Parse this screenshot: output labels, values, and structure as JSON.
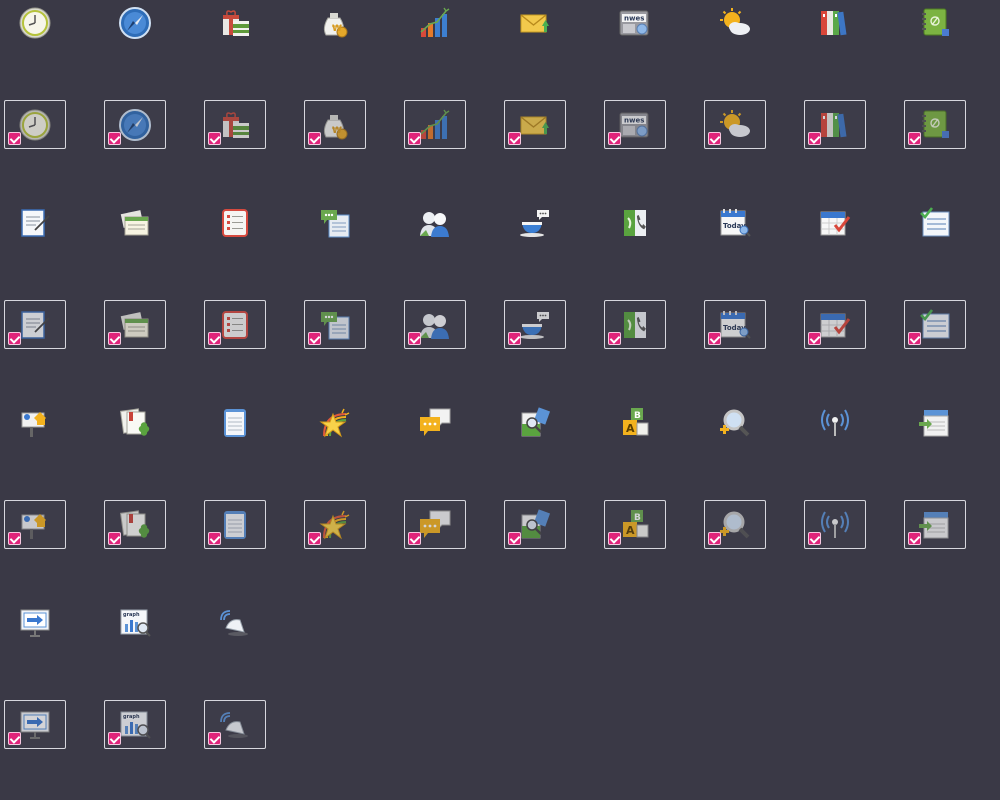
{
  "grid": {
    "rows": [
      {
        "state": "normal",
        "icons": [
          "clock-icon",
          "compass-icon",
          "gift-icon",
          "money-bag-icon",
          "growth-chart-icon",
          "mail-icon",
          "news-icon",
          "weather-icon",
          "binders-icon",
          "notebook-icon"
        ]
      },
      {
        "state": "selected",
        "icons": [
          "clock-icon",
          "compass-icon",
          "gift-icon",
          "money-bag-icon",
          "growth-chart-icon",
          "mail-icon",
          "news-icon",
          "weather-icon",
          "binders-icon",
          "notebook-icon"
        ]
      },
      {
        "state": "normal",
        "icons": [
          "memo-edit-icon",
          "cards-icon",
          "checklist-red-icon",
          "chat-document-icon",
          "users-icon",
          "coffee-icon",
          "phone-book-icon",
          "today-calendar-icon",
          "calendar-check-icon",
          "task-list-icon"
        ]
      },
      {
        "state": "selected",
        "icons": [
          "memo-edit-icon",
          "cards-icon",
          "checklist-red-icon",
          "chat-document-icon",
          "users-icon",
          "coffee-icon",
          "phone-book-icon",
          "today-calendar-icon",
          "calendar-check-icon",
          "task-list-icon"
        ]
      },
      {
        "state": "normal",
        "icons": [
          "signpost-icon",
          "clover-card-icon",
          "notepad-icon",
          "rainbow-star-icon",
          "speech-bubbles-icon",
          "document-search-icon",
          "abc-blocks-icon",
          "zoom-in-icon",
          "wireless-icon",
          "inbox-tray-icon"
        ]
      },
      {
        "state": "selected",
        "icons": [
          "signpost-icon",
          "clover-card-icon",
          "notepad-icon",
          "rainbow-star-icon",
          "speech-bubbles-icon",
          "document-search-icon",
          "abc-blocks-icon",
          "zoom-in-icon",
          "wireless-icon",
          "inbox-tray-icon"
        ]
      },
      {
        "state": "normal",
        "icons": [
          "presentation-arrow-icon",
          "graph-search-icon",
          "satellite-dish-icon"
        ]
      },
      {
        "state": "selected",
        "icons": [
          "presentation-arrow-icon",
          "graph-search-icon",
          "satellite-dish-icon"
        ]
      }
    ]
  },
  "icon_text": {
    "news": "nwes",
    "today": "Today",
    "graph": "graph",
    "block_a": "A",
    "block_b": "B",
    "currency": "₩"
  },
  "colors": {
    "background": "#3a3946",
    "selection_border": "#d7d7de",
    "checkbox": "#e0237a"
  }
}
